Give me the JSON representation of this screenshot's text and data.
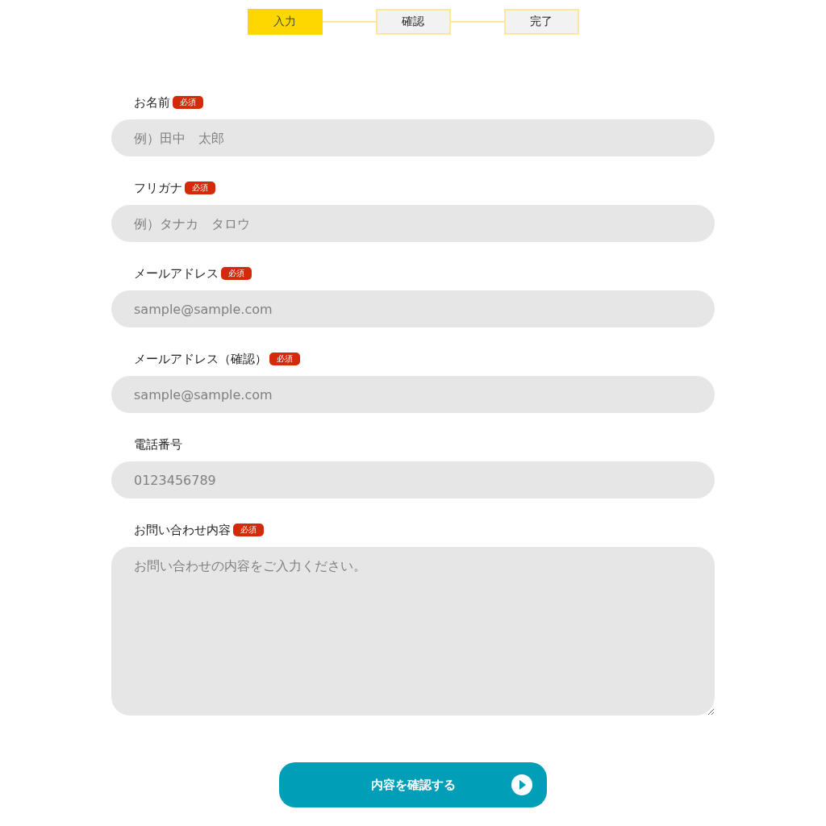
{
  "steps": [
    {
      "label": "入力",
      "selected": true
    },
    {
      "label": "確認",
      "selected": false
    },
    {
      "label": "完了",
      "selected": false
    }
  ],
  "fields": [
    {
      "kind": "input",
      "label": "お名前",
      "badge": "必須",
      "placeholder": "例）田中　太郎"
    },
    {
      "kind": "input",
      "label": "フリガナ",
      "badge": "必須",
      "placeholder": "例）タナカ　タロウ"
    },
    {
      "kind": "input",
      "label": "メールアドレス",
      "badge": "必須",
      "placeholder": "sample@sample.com"
    },
    {
      "kind": "input",
      "label": "メールアドレス（確認）",
      "badge": "必須",
      "placeholder": "sample@sample.com"
    },
    {
      "kind": "input",
      "label": "電話番号",
      "placeholder": "0123456789"
    },
    {
      "kind": "textarea",
      "label": "お問い合わせ内容",
      "badge": "必須",
      "placeholder": "お問い合わせの内容をご入力ください。"
    }
  ],
  "submit": {
    "label": "内容を確認する"
  }
}
